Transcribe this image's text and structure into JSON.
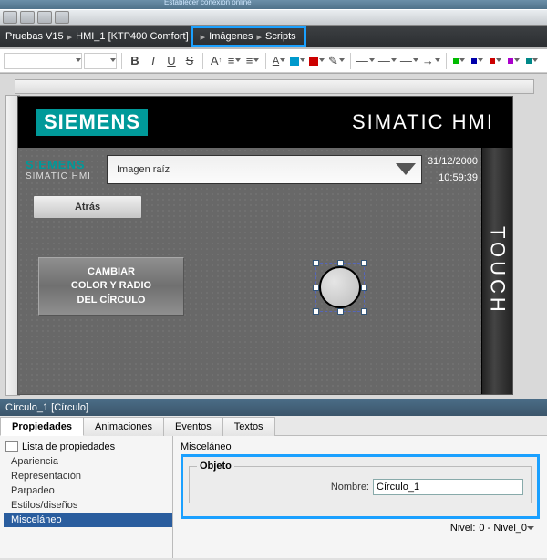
{
  "faded_title": "Establecer conexión online",
  "breadcrumb": {
    "parts": [
      "Pruebas V15",
      "HMI_1 [KTP400 Comfort]"
    ],
    "highlight": [
      "Imágenes",
      "Scripts"
    ]
  },
  "fmt": {
    "b": "B",
    "i": "I",
    "u": "U",
    "s": "S"
  },
  "hmi": {
    "siemens_big": "SIEMENS",
    "simatic_big": "SIMATIC HMI",
    "siemens_small": "SIEMENS",
    "simatic_small": "SIMATIC HMI",
    "root_image_label": "Imagen raíz",
    "date": "31/12/2000",
    "time": "10:59:39",
    "touch": "TOUCH",
    "atras": "Atrás",
    "big_btn": "CAMBIAR\nCOLOR Y RADIO\nDEL CÍRCULO"
  },
  "inspector": {
    "title": "Círculo_1 [Círculo]",
    "tabs": {
      "props": "Propiedades",
      "anim": "Animaciones",
      "events": "Eventos",
      "texts": "Textos"
    },
    "list_header": "Lista de propiedades",
    "items": [
      "Apariencia",
      "Representación",
      "Parpadeo",
      "Estilos/diseños",
      "Misceláneo"
    ],
    "panel_title": "Misceláneo",
    "group": "Objeto",
    "name_label": "Nombre:",
    "name_value": "Círculo_1",
    "level_label": "Nivel:",
    "level_value": "0 - Nivel_0"
  }
}
